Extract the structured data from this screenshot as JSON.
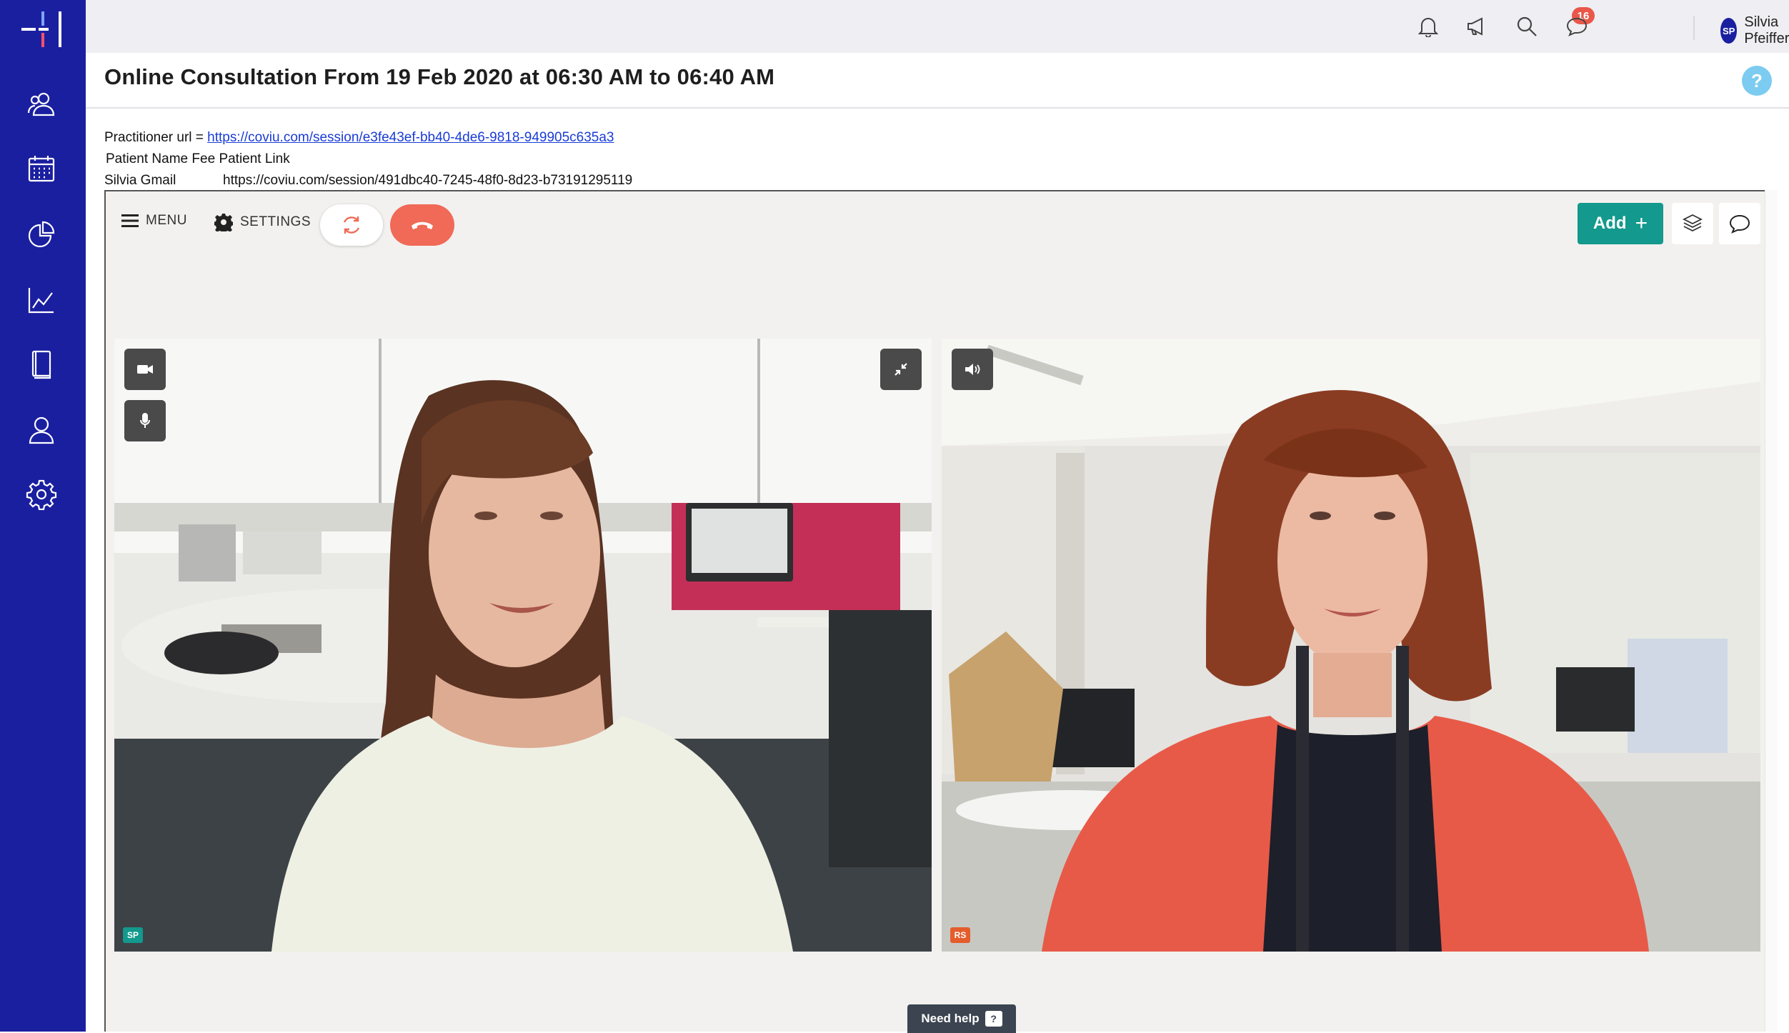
{
  "topbar": {
    "notification_count": "16",
    "user_initials": "SP",
    "user_name": "Silvia Pfeiffer"
  },
  "header": {
    "title": "Online Consultation From 19 Feb 2020 at 06:30 AM to 06:40 AM",
    "help_label": "?"
  },
  "info": {
    "practitioner_prefix": "Practitioner url = ",
    "practitioner_url": "https://coviu.com/session/e3fe43ef-bb40-4de6-9818-949905c635a3",
    "headers": {
      "patient_name": "Patient Name",
      "fee": "Fee",
      "patient_link": "Patient Link"
    },
    "row": {
      "patient_name": "Silvia Gmail",
      "patient_link": "https://coviu.com/session/491dbc40-7245-48f0-8d23-b73191295119"
    }
  },
  "video": {
    "menu_label": "MENU",
    "settings_label": "SETTINGS",
    "add_label": "Add",
    "add_plus": "+",
    "self_tag": "SP",
    "remote_tag": "RS",
    "need_help_label": "Need help",
    "need_help_icon": "?"
  },
  "colors": {
    "sidebar": "#1a1fa0",
    "add_button": "#13998d",
    "hangup": "#f06a57",
    "badge": "#e9574a",
    "link": "#1a3cd6",
    "self_tag": "#13998d",
    "remote_tag": "#e45d2d"
  },
  "icons": {
    "sidebar": [
      "people-icon",
      "calendar-icon",
      "pie-chart-icon",
      "line-chart-icon",
      "book-icon",
      "user-icon",
      "settings-gear-icon"
    ],
    "topbar": [
      "bell-icon",
      "megaphone-icon",
      "search-icon",
      "chat-icon"
    ]
  }
}
